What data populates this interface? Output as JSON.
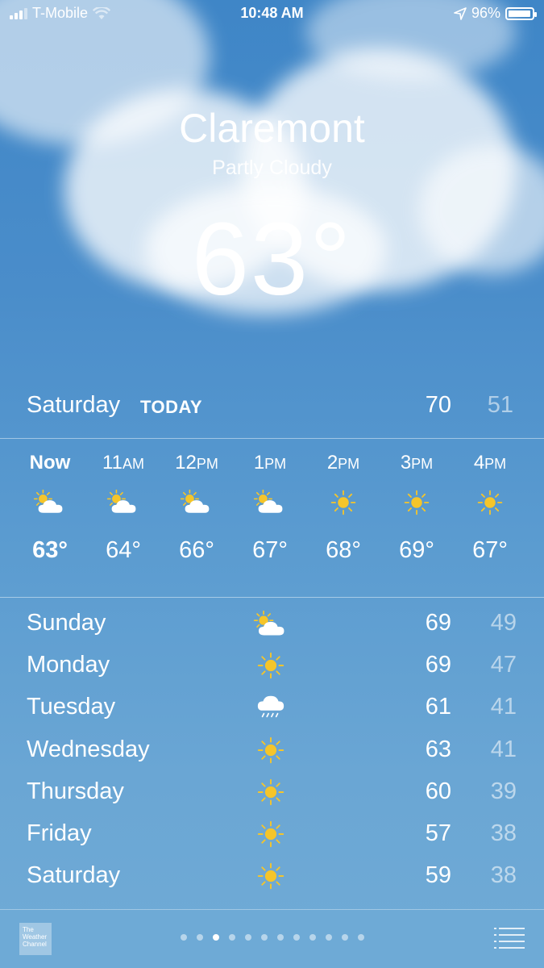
{
  "status_bar": {
    "carrier": "T-Mobile",
    "time": "10:48 AM",
    "battery_percent": "96%",
    "battery_level": 0.96,
    "signal_bars": 3,
    "signal_total": 4
  },
  "location": {
    "city": "Claremont",
    "condition": "Partly Cloudy",
    "temperature": "63°"
  },
  "today": {
    "day": "Saturday",
    "tag": "TODAY",
    "high": "70",
    "low": "51"
  },
  "hourly": [
    {
      "time": "Now",
      "ampm": "",
      "icon": "partly-cloudy-icon",
      "temp": "63°",
      "now": true
    },
    {
      "time": "11",
      "ampm": "AM",
      "icon": "partly-cloudy-icon",
      "temp": "64°"
    },
    {
      "time": "12",
      "ampm": "PM",
      "icon": "partly-cloudy-icon",
      "temp": "66°"
    },
    {
      "time": "1",
      "ampm": "PM",
      "icon": "partly-cloudy-icon",
      "temp": "67°"
    },
    {
      "time": "2",
      "ampm": "PM",
      "icon": "sun-icon",
      "temp": "68°"
    },
    {
      "time": "3",
      "ampm": "PM",
      "icon": "sun-icon",
      "temp": "69°"
    },
    {
      "time": "4",
      "ampm": "PM",
      "icon": "sun-icon",
      "temp": "67°"
    }
  ],
  "daily": [
    {
      "day": "Sunday",
      "icon": "partly-cloudy-icon",
      "high": "69",
      "low": "49"
    },
    {
      "day": "Monday",
      "icon": "sun-icon",
      "high": "69",
      "low": "47"
    },
    {
      "day": "Tuesday",
      "icon": "rain-cloud-icon",
      "high": "61",
      "low": "41"
    },
    {
      "day": "Wednesday",
      "icon": "sun-icon",
      "high": "63",
      "low": "41"
    },
    {
      "day": "Thursday",
      "icon": "sun-icon",
      "high": "60",
      "low": "39"
    },
    {
      "day": "Friday",
      "icon": "sun-icon",
      "high": "57",
      "low": "38"
    },
    {
      "day": "Saturday",
      "icon": "sun-icon",
      "high": "59",
      "low": "38"
    }
  ],
  "bottom_bar": {
    "logo_text": [
      "The",
      "Weather",
      "Channel"
    ],
    "page_count": 12,
    "active_page": 3
  },
  "colors": {
    "sun": "#f5c52a",
    "cloud": "#ffffff",
    "rain": "#ffffff"
  }
}
